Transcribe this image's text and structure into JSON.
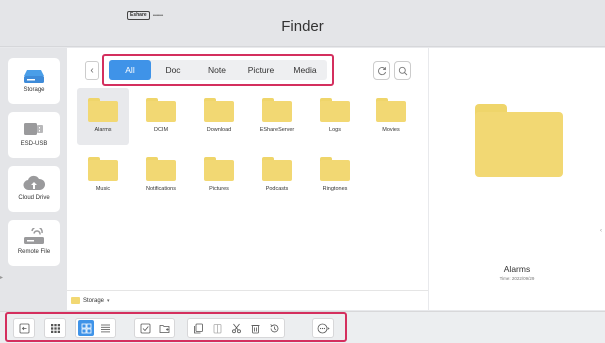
{
  "window": {
    "title": "Finder",
    "logo_text": "Eshare",
    "logo_dots": "••••••••"
  },
  "sidebar": {
    "items": [
      {
        "label": "Storage",
        "icon": "storage-icon"
      },
      {
        "label": "ESD-USB",
        "icon": "usb-drive-icon"
      },
      {
        "label": "Cloud Drive",
        "icon": "cloud-upload-icon"
      },
      {
        "label": "Remote File",
        "icon": "remote-storage-icon"
      }
    ]
  },
  "filter": {
    "tabs": [
      "All",
      "Doc",
      "Note",
      "Picture",
      "Media"
    ],
    "active": "All"
  },
  "files": [
    {
      "name": "Alarms"
    },
    {
      "name": "DCIM"
    },
    {
      "name": "Download"
    },
    {
      "name": "EShareServer"
    },
    {
      "name": "Logs"
    },
    {
      "name": "Movies"
    },
    {
      "name": "Music"
    },
    {
      "name": "Notifications"
    },
    {
      "name": "Pictures"
    },
    {
      "name": "Podcasts"
    },
    {
      "name": "Ringtones"
    }
  ],
  "path": {
    "current": "Storage",
    "caret": "▾"
  },
  "preview": {
    "name": "Alarms",
    "time": "Time: 2022/09/29"
  },
  "colors": {
    "accent": "#3f93e8",
    "folder": "#f2d873",
    "highlight": "#d42f5e"
  },
  "bottom_toolbar": {
    "buttons": [
      "exit-icon",
      "apps-grid-icon",
      "grid-view-icon",
      "list-view-icon",
      "select-icon",
      "new-folder-icon",
      "copy-icon",
      "paste-icon",
      "cut-icon",
      "delete-icon",
      "rename-icon",
      "more-icon"
    ]
  }
}
